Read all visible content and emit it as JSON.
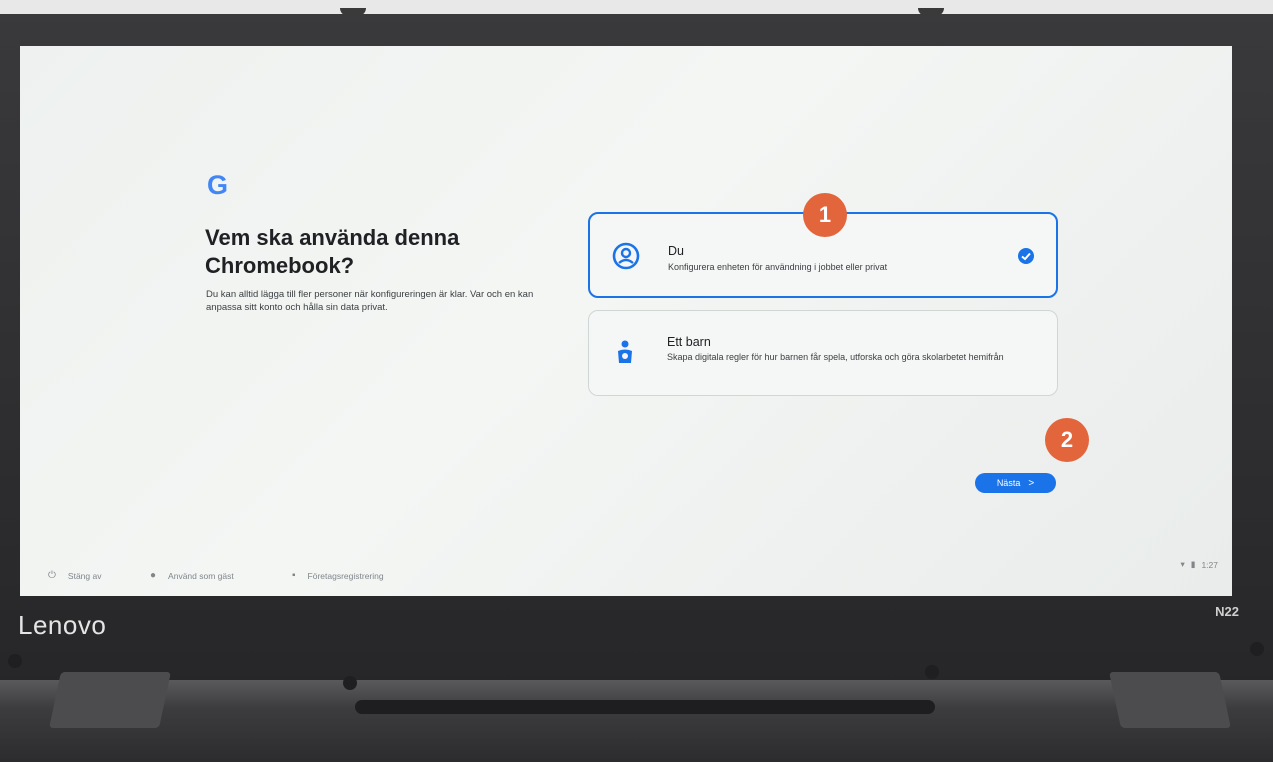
{
  "setup": {
    "logo_letter": "G",
    "title": "Vem ska använda denna Chromebook?",
    "description": "Du kan alltid lägga till fler personer när konfigureringen är klar. Var och en kan anpassa sitt konto och hålla sin data privat.",
    "options": [
      {
        "title": "Du",
        "subtitle": "Konfigurera enheten för användning i jobbet eller privat",
        "selected": true,
        "icon": "person-circle-icon"
      },
      {
        "title": "Ett barn",
        "subtitle": "Skapa digitala regler för hur barnen får spela, utforska och göra skolarbetet hemifrån",
        "selected": false,
        "icon": "child-icon"
      }
    ],
    "next_label": "Nästa"
  },
  "annotations": {
    "marker1": "1",
    "marker2": "2"
  },
  "shelf": {
    "shutdown": "Stäng av",
    "guest": "Använd som gäst",
    "enterprise": "Företagsregistrering",
    "time": "1:27"
  },
  "device": {
    "brand": "Lenovo",
    "model": "N22"
  },
  "colors": {
    "accent": "#1a73e8",
    "marker": "#e2653c"
  }
}
